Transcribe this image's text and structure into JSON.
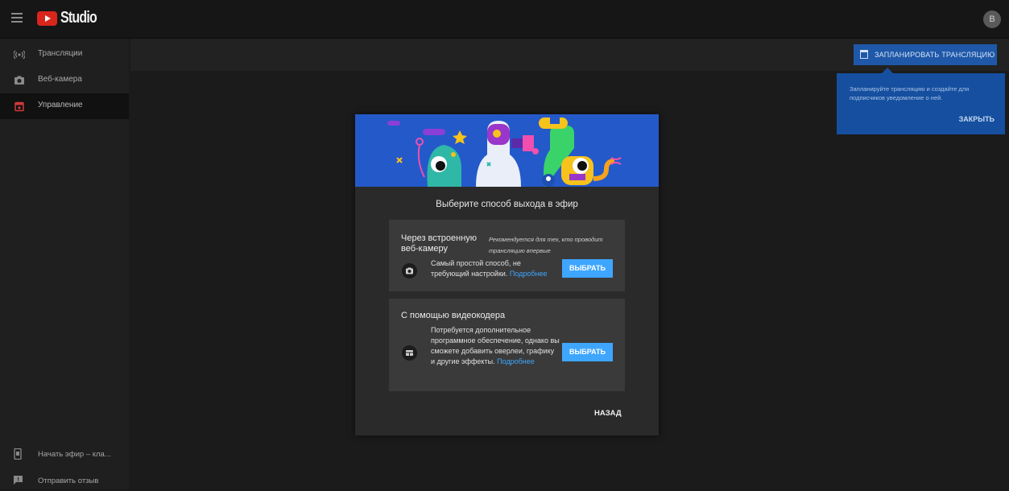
{
  "header": {
    "app_name": "Studio",
    "avatar_letter": "В"
  },
  "sidebar": {
    "items": [
      {
        "label": "Трансляции",
        "icon": "broadcast-icon"
      },
      {
        "label": "Веб-камера",
        "icon": "camera-icon"
      },
      {
        "label": "Управление",
        "icon": "calendar-icon",
        "active": true
      }
    ],
    "bottom_items": [
      {
        "label": "Начать эфир – кла...",
        "icon": "phone-icon"
      },
      {
        "label": "Отправить отзыв",
        "icon": "feedback-icon"
      }
    ]
  },
  "schedule": {
    "button_label": "ЗАПЛАНИРОВАТЬ ТРАНСЛЯЦИЮ",
    "tooltip_text": "Запланируйте трансляцию и создайте для подписчиков уведомление о ней.",
    "tooltip_close": "ЗАКРЫТЬ"
  },
  "modal": {
    "title": "Выберите способ выхода в эфир",
    "webcam": {
      "title": "Через встроенную веб-камеру",
      "recommend": "Рекомендуется для тех, кто проводит трансляцию впервые",
      "desc": "Самый простой способ, не требующий настройки.",
      "link": "Подробнее",
      "button": "ВЫБРАТЬ"
    },
    "encoder": {
      "title": "С помощью видеокодера",
      "desc": "Потребуется дополнительное программное обеспечение, однако вы сможете добавить оверлеи, графику и другие эффекты.",
      "link": "Подробнее",
      "button": "ВЫБРАТЬ"
    },
    "back": "НАЗАД"
  },
  "colors": {
    "accent": "#3ea6ff",
    "brand_red": "#d9261c",
    "tooltip_bg": "#164f9f",
    "modal_bg": "#2a2a2a"
  }
}
